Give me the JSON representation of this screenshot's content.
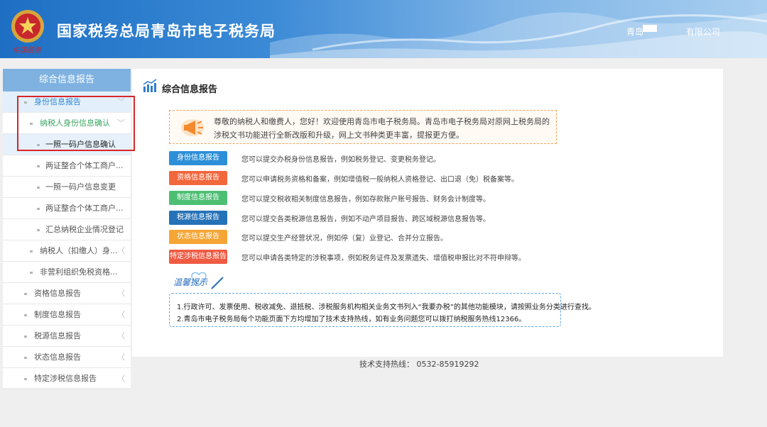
{
  "header": {
    "emblem_text": "中国税务",
    "site_title": "国家税务总局青岛市电子税务局",
    "user_name": "青岛",
    "company": "有限公司"
  },
  "sidebar": {
    "heading": "综合信息报告",
    "items": [
      {
        "label": "身份信息报告",
        "arrow": "﹀"
      },
      {
        "label": "纳税人身份信息确认",
        "arrow": "﹀"
      },
      {
        "label": "一照一码户信息确认",
        "arrow": ""
      },
      {
        "label": "两证整合个体工商户...",
        "arrow": ""
      },
      {
        "label": "一照一码户信息变更",
        "arrow": ""
      },
      {
        "label": "两证整合个体工商户...",
        "arrow": ""
      },
      {
        "label": "汇总纳税企业情况登记",
        "arrow": ""
      },
      {
        "label": "纳税人（扣缴人）身...",
        "arrow": "〈"
      },
      {
        "label": "非营利组织免税资格...",
        "arrow": ""
      },
      {
        "label": "资格信息报告",
        "arrow": "〈"
      },
      {
        "label": "制度信息报告",
        "arrow": "〈"
      },
      {
        "label": "税源信息报告",
        "arrow": "〈"
      },
      {
        "label": "状态信息报告",
        "arrow": "〈"
      },
      {
        "label": "特定涉税信息报告",
        "arrow": "〈"
      }
    ]
  },
  "main": {
    "title": "综合信息报告",
    "welcome": "尊敬的纳税人和缴费人，您好！欢迎使用青岛市电子税务局。青岛市电子税务局对原网上税务局的涉税文书功能进行全新改版和升级，网上文书种类更丰富，提报更方便。",
    "categories": [
      {
        "label": "身份信息报告",
        "color": "#2d8fd8",
        "desc": "您可以提交办税身份信息报告，例如税务登记、变更税务登记。"
      },
      {
        "label": "资格信息报告",
        "color": "#f2673c",
        "desc": "您可以申请税务资格和备案，例如增值税一般纳税人资格登记、出口退（免）税备案等。"
      },
      {
        "label": "制度信息报告",
        "color": "#4cbf73",
        "desc": "您可以提交税收相关制度信息报告，例如存款账户账号报告、财务会计制度等。"
      },
      {
        "label": "税源信息报告",
        "color": "#2572b8",
        "desc": "您可以提交各类税源信息报告，例如不动产项目报告、跨区域税源信息报告等。"
      },
      {
        "label": "状态信息报告",
        "color": "#f5a534",
        "desc": "您可以提交生产经营状况，例如停（复）业登记、合并分立报告。"
      },
      {
        "label": "特定涉税信息报告",
        "color": "#ef5b43",
        "desc": "您可以申请各类特定的涉税事项，例如税务证件及发票遗失、增值税申报比对不符申辩等。"
      }
    ],
    "tip_logo": "温馨提示",
    "tips": [
      "1.行政许可、发票使用、税收减免、退抵税、涉税服务机构相关业务文书列入“我要办税”的其他功能模块，请按照业务分类进行查找。",
      "2.青岛市电子税务局每个功能页面下方均增加了技术支持热线，如有业务问题您可以拨打纳税服务热线12366。"
    ]
  },
  "footer": {
    "hotline": "技术支持热线： 0532-85919292"
  }
}
